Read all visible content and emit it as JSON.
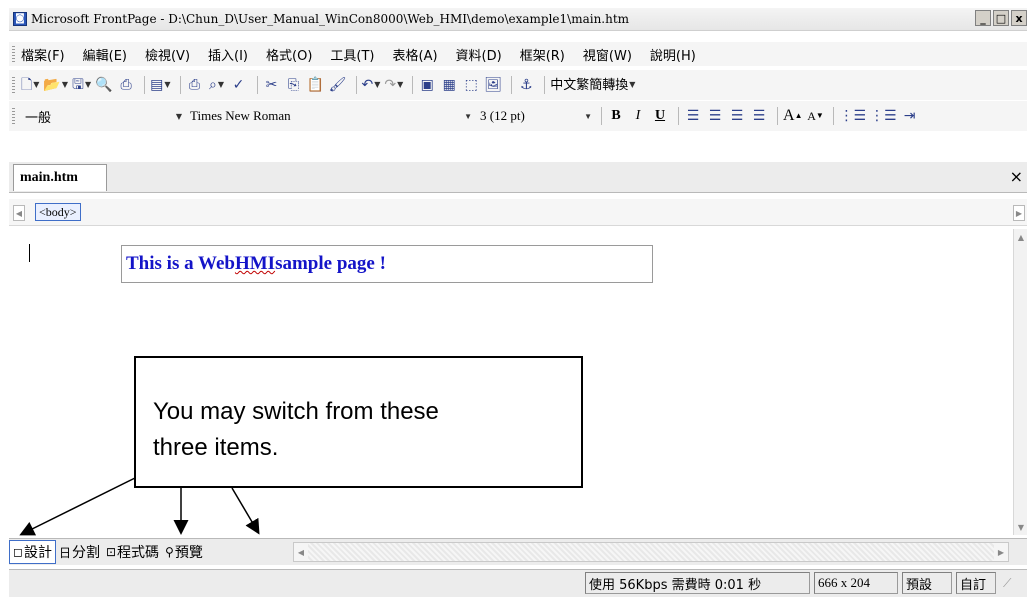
{
  "window": {
    "title": "Microsoft FrontPage - D:\\Chun_D\\User_Manual_WinCon8000\\Web_HMI\\demo\\example1\\main.htm",
    "buttons": [
      "_",
      "□",
      "x"
    ]
  },
  "menu": [
    "檔案(F)",
    "編輯(E)",
    "檢視(V)",
    "插入(I)",
    "格式(O)",
    "工具(T)",
    "表格(A)",
    "資料(D)",
    "框架(R)",
    "視窗(W)",
    "說明(H)"
  ],
  "toolbar": {
    "convert_label": "中文繁簡轉換",
    "style_value": "一般",
    "font_value": "Times New Roman",
    "size_value": "3 (12 pt)",
    "bold": "B",
    "italic": "I",
    "underline": "U",
    "grow_font": "A",
    "shrink_font": "A"
  },
  "document": {
    "tab_label": "main.htm",
    "tag": "<body>",
    "content_pre": "This is a Web ",
    "content_hmi": "HMI",
    "content_post": " sample page !"
  },
  "callout": {
    "line1": "You may switch from these",
    "line2": "three items."
  },
  "views": [
    {
      "label": "設計",
      "icon": "design-view-icon",
      "glyph": "◻",
      "active": true
    },
    {
      "label": "分割",
      "icon": "split-view-icon",
      "glyph": "日",
      "active": false
    },
    {
      "label": "程式碼",
      "icon": "code-view-icon",
      "glyph": "⊡",
      "active": false
    },
    {
      "label": "預覽",
      "icon": "preview-icon",
      "glyph": "⚲",
      "active": false
    }
  ],
  "status": {
    "download": "使用 56Kbps 需費時 0:01 秒",
    "dimensions": "666 x 204",
    "preset": "預設",
    "custom": "自訂"
  },
  "colors": {
    "content_text": "#1414c8",
    "selection": "#3f6ec8"
  }
}
